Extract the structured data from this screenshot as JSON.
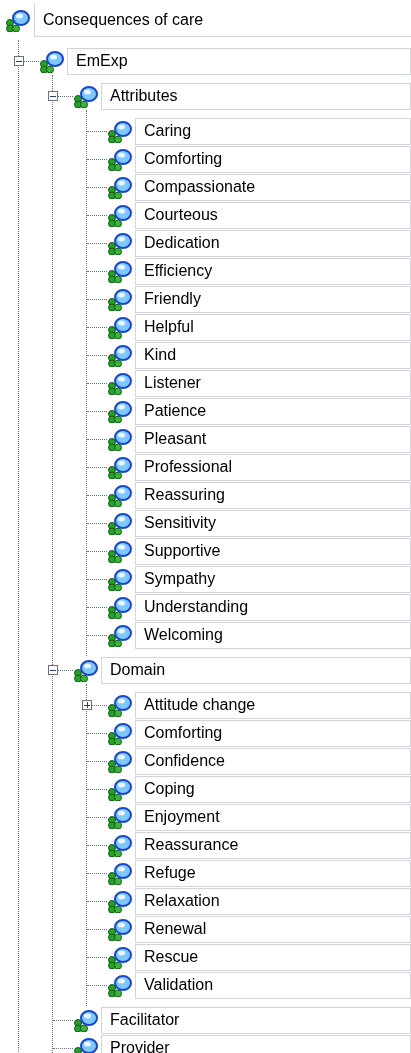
{
  "tree": {
    "label": "Consequences of care",
    "children": [
      {
        "label": "EmExp",
        "expanded": true,
        "children": [
          {
            "label": "Attributes",
            "expanded": true,
            "children": [
              {
                "label": "Caring"
              },
              {
                "label": "Comforting"
              },
              {
                "label": "Compassionate"
              },
              {
                "label": "Courteous"
              },
              {
                "label": "Dedication"
              },
              {
                "label": "Efficiency"
              },
              {
                "label": "Friendly"
              },
              {
                "label": "Helpful"
              },
              {
                "label": "Kind"
              },
              {
                "label": "Listener"
              },
              {
                "label": "Patience"
              },
              {
                "label": "Pleasant"
              },
              {
                "label": "Professional"
              },
              {
                "label": "Reassuring"
              },
              {
                "label": "Sensitivity"
              },
              {
                "label": "Supportive"
              },
              {
                "label": "Sympathy"
              },
              {
                "label": "Understanding"
              },
              {
                "label": "Welcoming"
              }
            ]
          },
          {
            "label": "Domain",
            "expanded": true,
            "children": [
              {
                "label": "Attitude change",
                "expanded": false
              },
              {
                "label": "Comforting"
              },
              {
                "label": "Confidence"
              },
              {
                "label": "Coping"
              },
              {
                "label": "Enjoyment"
              },
              {
                "label": "Reassurance"
              },
              {
                "label": "Refuge"
              },
              {
                "label": "Relaxation"
              },
              {
                "label": "Renewal"
              },
              {
                "label": "Rescue"
              },
              {
                "label": "Validation"
              }
            ]
          },
          {
            "label": "Facilitator"
          },
          {
            "label": "Provider"
          }
        ]
      }
    ]
  }
}
